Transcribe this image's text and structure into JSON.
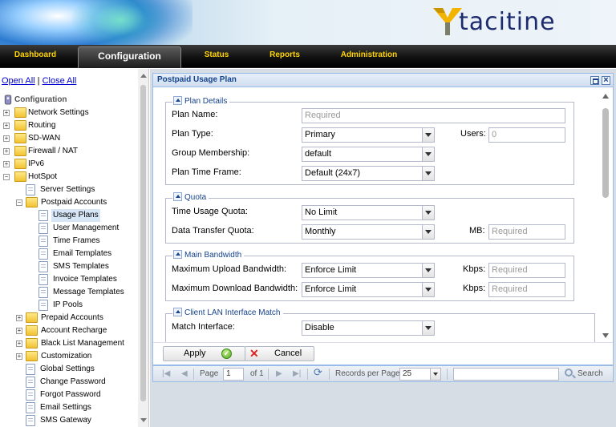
{
  "brand": {
    "name": "tacitine"
  },
  "nav": {
    "items": [
      "Dashboard",
      "Configuration",
      "Status",
      "Reports",
      "Administration"
    ],
    "active": "Configuration"
  },
  "sidebar": {
    "open_all": "Open All",
    "separator": "|",
    "close_all": "Close All",
    "tree": [
      "Configuration",
      "Network Settings",
      "Routing",
      "SD-WAN",
      "Firewall / NAT",
      "IPv6",
      "HotSpot",
      "Server Settings",
      "Postpaid Accounts",
      "Usage Plans",
      "User Management",
      "Time Frames",
      "Email Templates",
      "SMS Templates",
      "Invoice Templates",
      "Message Templates",
      "IP Pools",
      "Prepaid Accounts",
      "Account Recharge",
      "Black List Management",
      "Customization",
      "Global Settings",
      "Change Password",
      "Forgot Password",
      "Email Settings",
      "SMS Gateway"
    ],
    "selected": "Usage Plans"
  },
  "panel": {
    "title": "Postpaid Usage Plan",
    "plan_details": {
      "legend": "Plan Details",
      "plan_name_label": "Plan Name:",
      "plan_name_placeholder": "Required",
      "plan_type_label": "Plan Type:",
      "plan_type_value": "Primary",
      "users_label": "Users:",
      "users_value": "0",
      "group_membership_label": "Group Membership:",
      "group_membership_value": "default",
      "time_frame_label": "Plan Time Frame:",
      "time_frame_value": "Default (24x7)"
    },
    "quota": {
      "legend": "Quota",
      "time_usage_label": "Time Usage Quota:",
      "time_usage_value": "No Limit",
      "data_transfer_label": "Data Transfer Quota:",
      "data_transfer_value": "Monthly",
      "mb_label": "MB:",
      "mb_placeholder": "Required"
    },
    "bandwidth": {
      "legend": "Main Bandwidth",
      "upload_label": "Maximum Upload Bandwidth:",
      "upload_value": "Enforce Limit",
      "upload_kbps_label": "Kbps:",
      "upload_kbps_placeholder": "Required",
      "download_label": "Maximum Download Bandwidth:",
      "download_value": "Enforce Limit",
      "download_kbps_label": "Kbps:",
      "download_kbps_placeholder": "Required"
    },
    "lan_match": {
      "legend": "Client LAN Interface Match",
      "match_label": "Match Interface:",
      "match_value": "Disable"
    },
    "apply_label": "Apply",
    "cancel_label": "Cancel"
  },
  "pager": {
    "page_label": "Page",
    "page_value": "1",
    "of_label": "of 1",
    "records_label": "Records per Page",
    "records_value": "25",
    "search_label": "Search"
  }
}
